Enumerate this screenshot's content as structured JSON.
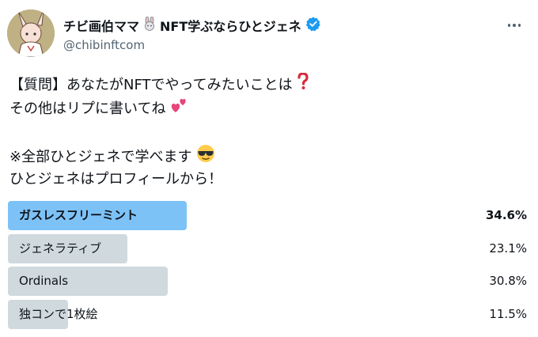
{
  "author": {
    "display_name_prefix": "チビ画伯ママ",
    "display_name_suffix": "NFT学ぶならひとジェネ",
    "handle": "@chibinftcom",
    "verified": true
  },
  "tweet": {
    "lines": [
      "【質問】あなたがNFTでやってみたいことは",
      "その他はリプに書いてね",
      "",
      "※全部ひとジェネで学べます",
      "ひとジェネはプロフィールから！"
    ]
  },
  "poll": {
    "options": [
      {
        "label": "ガスレスフリーミント",
        "percent": 34.6,
        "percent_text": "34.6%",
        "winner": true
      },
      {
        "label": "ジェネラティブ",
        "percent": 23.1,
        "percent_text": "23.1%",
        "winner": false
      },
      {
        "label": "Ordinals",
        "percent": 30.8,
        "percent_text": "30.8%",
        "winner": false
      },
      {
        "label": "独コンで1枚絵",
        "percent": 11.5,
        "percent_text": "11.5%",
        "winner": false
      }
    ]
  },
  "colors": {
    "winner_bar": "#7dc2f7",
    "bar": "#cfd9de",
    "verified": "#1d9bf0",
    "handle": "#536471"
  }
}
